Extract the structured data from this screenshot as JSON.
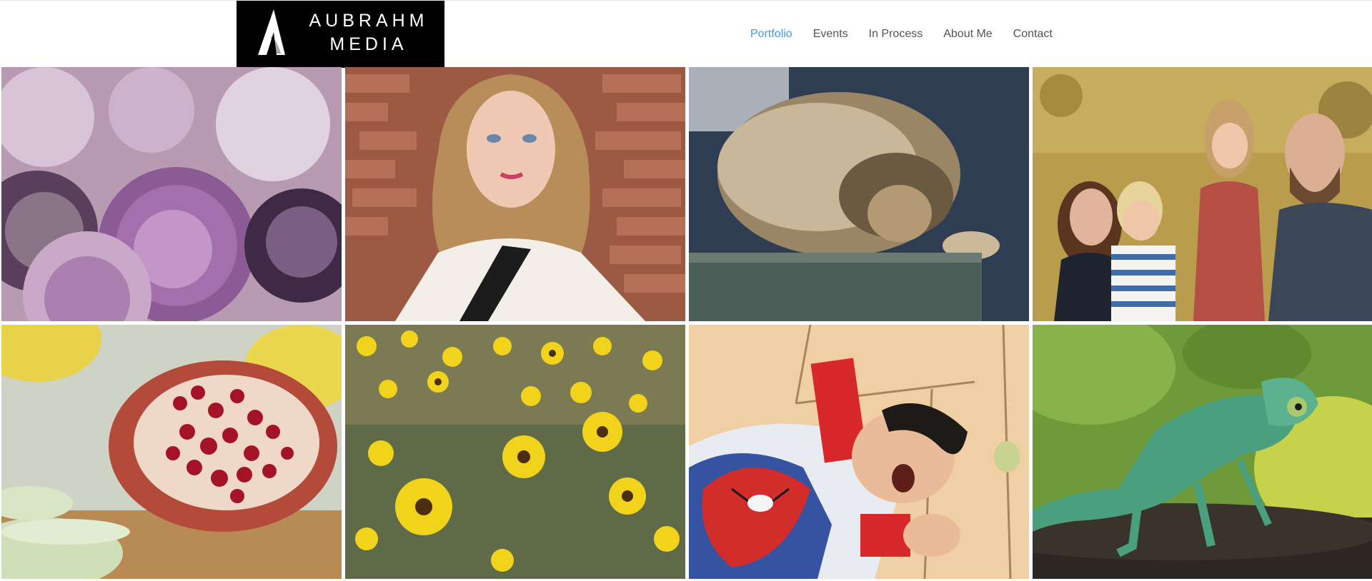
{
  "logo": {
    "line1": "AUBRAHM",
    "line2": "MEDIA"
  },
  "nav": [
    {
      "label": "Portfolio",
      "active": true
    },
    {
      "label": "Events",
      "active": false
    },
    {
      "label": "In Process",
      "active": false
    },
    {
      "label": "About Me",
      "active": false
    },
    {
      "label": "Contact",
      "active": false
    }
  ],
  "colors": {
    "nav_active": "#4a9ad9",
    "nav_text": "#555555",
    "logo_bg": "#000000"
  },
  "gallery": [
    {
      "subject": "amethyst geodes"
    },
    {
      "subject": "woman portrait brick wall"
    },
    {
      "subject": "sleeping lion"
    },
    {
      "subject": "family portrait"
    },
    {
      "subject": "pomegranate and cucumber"
    },
    {
      "subject": "yellow wildflowers"
    },
    {
      "subject": "child in spider-man pajamas"
    },
    {
      "subject": "green chameleon"
    }
  ]
}
